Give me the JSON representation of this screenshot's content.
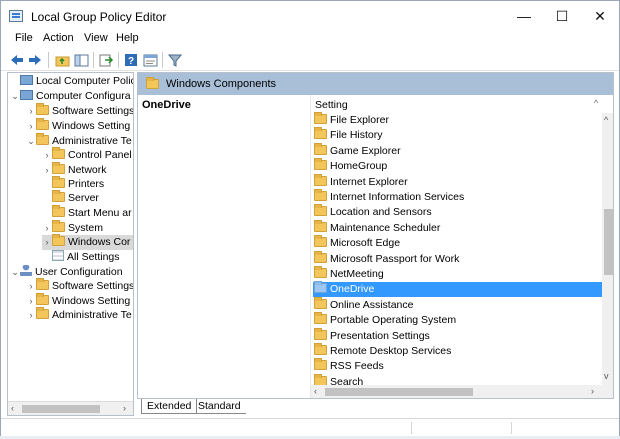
{
  "window": {
    "title": "Local Group Policy Editor",
    "buttons": {
      "minimize": "—",
      "maximize": "☐",
      "close": "✕"
    }
  },
  "menu": [
    "File",
    "Action",
    "View",
    "Help"
  ],
  "toolbar": [
    "back-icon",
    "forward-icon",
    "up-folder-icon",
    "show-hide-tree-icon",
    "export-list-icon",
    "help-icon",
    "properties-icon",
    "filter-icon"
  ],
  "tree": {
    "root": "Local Computer Policy",
    "computer": "Computer Configura",
    "computer_children": {
      "software": "Software Settings",
      "windows": "Windows Setting",
      "admin": "Administrative Te"
    },
    "admin_children": {
      "control_panel": "Control Panel",
      "network": "Network",
      "printers": "Printers",
      "server": "Server",
      "start_menu": "Start Menu ar",
      "system": "System",
      "windows_components": "Windows Cor",
      "all_settings": "All Settings"
    },
    "user": "User Configuration",
    "user_children": {
      "software": "Software Settings",
      "windows": "Windows Setting",
      "admin": "Administrative Te"
    }
  },
  "right": {
    "header": "Windows Components",
    "description_title": "OneDrive",
    "column_header": "Setting",
    "items": [
      "File Explorer",
      "File History",
      "Game Explorer",
      "HomeGroup",
      "Internet Explorer",
      "Internet Information Services",
      "Location and Sensors",
      "Maintenance Scheduler",
      "Microsoft Edge",
      "Microsoft Passport for Work",
      "NetMeeting",
      "OneDrive",
      "Online Assistance",
      "Portable Operating System",
      "Presentation Settings",
      "Remote Desktop Services",
      "RSS Feeds",
      "Search"
    ],
    "selected_item": "OneDrive"
  },
  "tabs": {
    "extended": "Extended",
    "standard": "Standard"
  },
  "colors": {
    "accent": "#3399ff",
    "header_bar": "#a9bfd8",
    "folder": "#f2c65b"
  }
}
